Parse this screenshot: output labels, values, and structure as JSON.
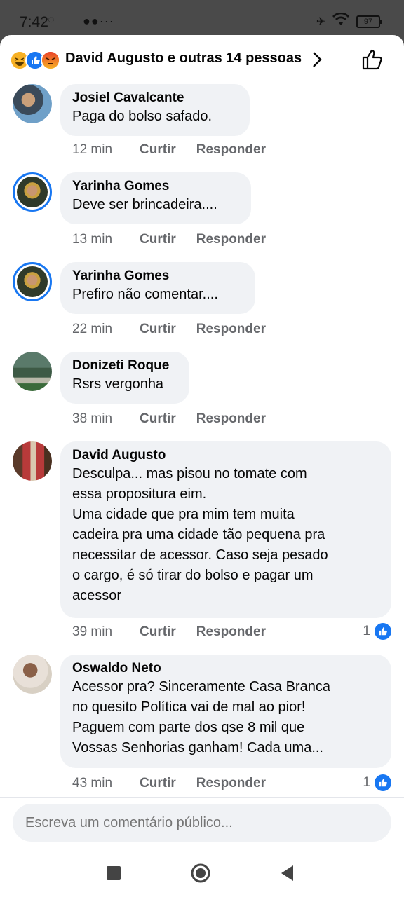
{
  "status_bar": {
    "time": "7:42",
    "battery": "97"
  },
  "header": {
    "title": "David Augusto e outras 14 pessoas"
  },
  "comments": [
    {
      "author": "Josiel Cavalcante",
      "text": "Paga do bolso safado.",
      "time": "12 min",
      "like_label": "Curtir",
      "reply_label": "Responder"
    },
    {
      "author": "Yarinha Gomes",
      "text": "Deve ser brincadeira....",
      "time": "13 min",
      "like_label": "Curtir",
      "reply_label": "Responder"
    },
    {
      "author": "Yarinha Gomes",
      "text": "Prefiro não comentar....",
      "time": "22 min",
      "like_label": "Curtir",
      "reply_label": "Responder"
    },
    {
      "author": "Donizeti Roque",
      "text": "Rsrs vergonha",
      "time": "38 min",
      "like_label": "Curtir",
      "reply_label": "Responder"
    },
    {
      "author": "David Augusto",
      "text": "Desculpa... mas pisou no tomate com\nessa propositura eim.\nUma cidade que pra mim tem muita\ncadeira pra uma cidade tão pequena pra\nnecessitar de acessor. Caso seja pesado\no cargo, é só tirar do bolso e pagar um\nacessor",
      "time": "39 min",
      "like_label": "Curtir",
      "reply_label": "Responder",
      "likes": "1"
    },
    {
      "author": "Oswaldo Neto",
      "text": "Acessor pra? Sinceramente Casa Branca\nno quesito Política vai de mal ao pior!\nPaguem com parte dos qse 8 mil que\nVossas Senhorias ganham! Cada uma...",
      "time": "43 min",
      "like_label": "Curtir",
      "reply_label": "Responder",
      "likes": "1"
    }
  ],
  "composer": {
    "placeholder": "Escreva um comentário público..."
  },
  "colors": {
    "accent": "#1877f2",
    "bubble": "#f0f2f5",
    "meta": "#65676b"
  }
}
